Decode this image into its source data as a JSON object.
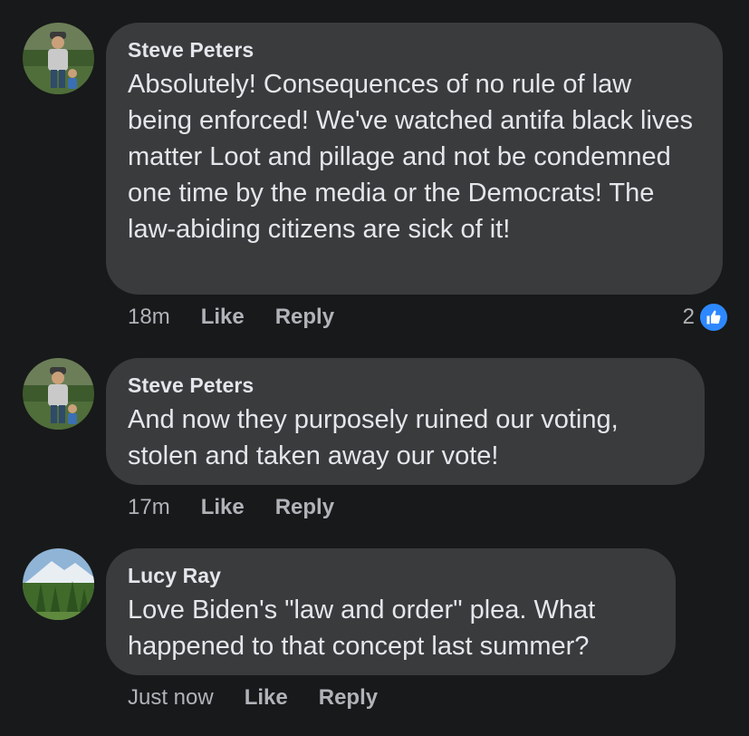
{
  "comments": [
    {
      "author": "Steve Peters",
      "text": "Absolutely! Consequences of no rule of law being enforced! We've watched antifa black lives matter Loot and pillage and not be condemned one time by the media or the Democrats! The law-abiding citizens are sick of it!",
      "time": "18m",
      "like_label": "Like",
      "reply_label": "Reply",
      "reaction_count": "2",
      "reaction_icon": "thumbs-up-icon"
    },
    {
      "author": "Steve Peters",
      "text": "And now they purposely ruined our voting, stolen and taken away our vote!",
      "time": "17m",
      "like_label": "Like",
      "reply_label": "Reply"
    },
    {
      "author": "Lucy Ray",
      "text": "Love Biden's \"law and order\" plea. What happened to that concept last summer?",
      "time": "Just now",
      "like_label": "Like",
      "reply_label": "Reply"
    }
  ],
  "colors": {
    "background": "#18191a",
    "bubble": "#3a3b3c",
    "primary_text": "#e4e6eb",
    "secondary_text": "#b0b3b8",
    "like_blue": "#2d88ff"
  }
}
